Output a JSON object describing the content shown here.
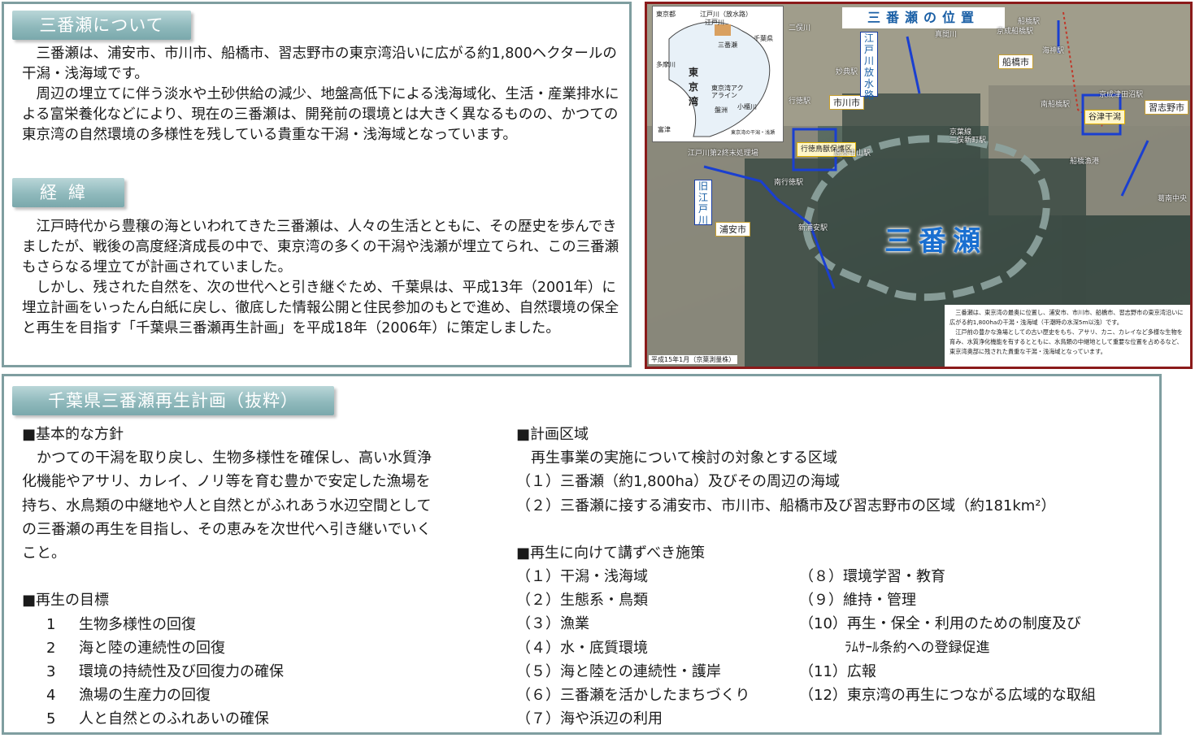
{
  "about": {
    "heading": "三番瀬について",
    "paragraphs": [
      "三番瀬は、浦安市、市川市、船橋市、習志野市の東京湾沿いに広がる約1,800ヘクタールの干潟・浅海域です。",
      "周辺の埋立てに伴う淡水や土砂供給の減少、地盤高低下による浅海域化、生活・産業排水による富栄養化などにより、現在の三番瀬は、開発前の環境とは大きく異なるものの、かつての東京湾の自然環境の多様性を残している貴重な干潟・浅海域となっています。"
    ]
  },
  "history": {
    "heading": "経緯",
    "paragraphs": [
      "江戸時代から豊穣の海といわれてきた三番瀬は、人々の生活とともに、その歴史を歩んできましたが、戦後の高度経済成長の中で、東京湾の多くの干潟や浅瀬が埋立てられ、この三番瀬もさらなる埋立てが計画されていました。",
      "しかし、残された自然を、次の世代へと引き継ぐため、千葉県は、平成13年（2001年）に埋立計画をいったん白紙に戻し、徹底した情報公開と住民参加のもとで進め、自然環境の保全と再生を目指す「千葉県三番瀬再生計画」を平成18年（2006年）に策定しました。"
    ]
  },
  "map": {
    "title": "三番瀬の位置",
    "big_label": "三番瀬",
    "cities": [
      "浦安市",
      "市川市",
      "船橋市",
      "習志野市"
    ],
    "rivers": [
      "江戸川放水路",
      "旧江戸川",
      "谷津干潟",
      "行徳鳥獣保護区"
    ],
    "stations": [
      "行徳駅",
      "妙典駅",
      "原木中山駅",
      "二俣新町駅",
      "南行徳駅",
      "新浦安駅",
      "江戸川第2終末処理場",
      "船橋駅",
      "京成船橋駅",
      "海神駅",
      "南船橋駅",
      "京成津田沼駅",
      "京葉線",
      "船橋漁港",
      "葛南中央",
      "真間川",
      "二俣川"
    ],
    "inset_labels": [
      "東京都",
      "江戸川（放水路）",
      "江戸川",
      "千葉県",
      "多摩川",
      "東京湾",
      "三番瀬",
      "東京湾アクアライン",
      "盤洲",
      "小櫃川",
      "富津",
      "東京湾の干潟・浅瀬"
    ],
    "note_paragraphs": [
      "三番瀬は、東京湾の最奥に位置し、浦安市、市川市、船橋市、習志野市の東京湾沿いに広がる約1,800haの干潟・浅海域（干潮時の水深5m以浅）です。",
      "江戸前の豊かな漁場としての古い歴史をもち、アサリ、カニ、カレイなど多様な生物を育み、水質浄化機能を有するとともに、水鳥類の中継地として重要な位置を占めるなど、東京湾奥部に残された貴重な干潟・浅海域となっています。"
    ],
    "credit": "平成15年1月（京葉測量株）"
  },
  "plan": {
    "heading": "千葉県三番瀬再生計画（抜粋）",
    "policy": {
      "heading": "■基本的な方針",
      "lines": [
        "かつての干潟を取り戻し、生物多様性を確保し、高い水質浄",
        "化機能やアサリ、カレイ、ノリ等を育む豊かで安定した漁場を",
        "持ち、水鳥類の中継地や人と自然とがふれあう水辺空間として",
        "の三番瀬の再生を目指し、その恵みを次世代へ引き継いでいく",
        "こと。"
      ]
    },
    "goals": {
      "heading": "■再生の目標",
      "items": [
        {
          "num": "1",
          "text": "生物多様性の回復"
        },
        {
          "num": "2",
          "text": "海と陸の連続性の回復"
        },
        {
          "num": "3",
          "text": "環境の持続性及び回復力の確保"
        },
        {
          "num": "4",
          "text": "漁場の生産力の回復"
        },
        {
          "num": "5",
          "text": "人と自然とのふれあいの確保"
        }
      ]
    },
    "area": {
      "heading": "■計画区域",
      "intro": "再生事業の実施について検討の対象とする区域",
      "items": [
        "（１）三番瀬（約1,800ha）及びその周辺の海域",
        "（２）三番瀬に接する浦安市、市川市、船橋市及び習志野市の区域（約181km²）"
      ]
    },
    "measures": {
      "heading": "■再生に向けて講ずべき施策",
      "col_a": [
        "（１）干潟・浅海域",
        "（２）生態系・鳥類",
        "（３）漁業",
        "（４）水・底質環境",
        "（５）海と陸との連続性・護岸",
        "（６）三番瀬を活かしたまちづくり",
        "（７）海や浜辺の利用"
      ],
      "col_b": [
        "（８）環境学習・教育",
        "（９）維持・管理",
        "（10）再生・保全・利用のための制度及び",
        "ﾗﾑｻｰﾙ条約への登録促進",
        "（11）広報",
        "（12）東京湾の再生につながる広域的な取組"
      ]
    }
  },
  "colors": {
    "panel_border": "#7f9ea0",
    "tab_fill": "#8fb9bc",
    "map_border": "#8b1a1a",
    "map_title": "#1a5fa5",
    "sanbanze_label": "#1a6fd0",
    "river_line": "#1a3fd0"
  }
}
